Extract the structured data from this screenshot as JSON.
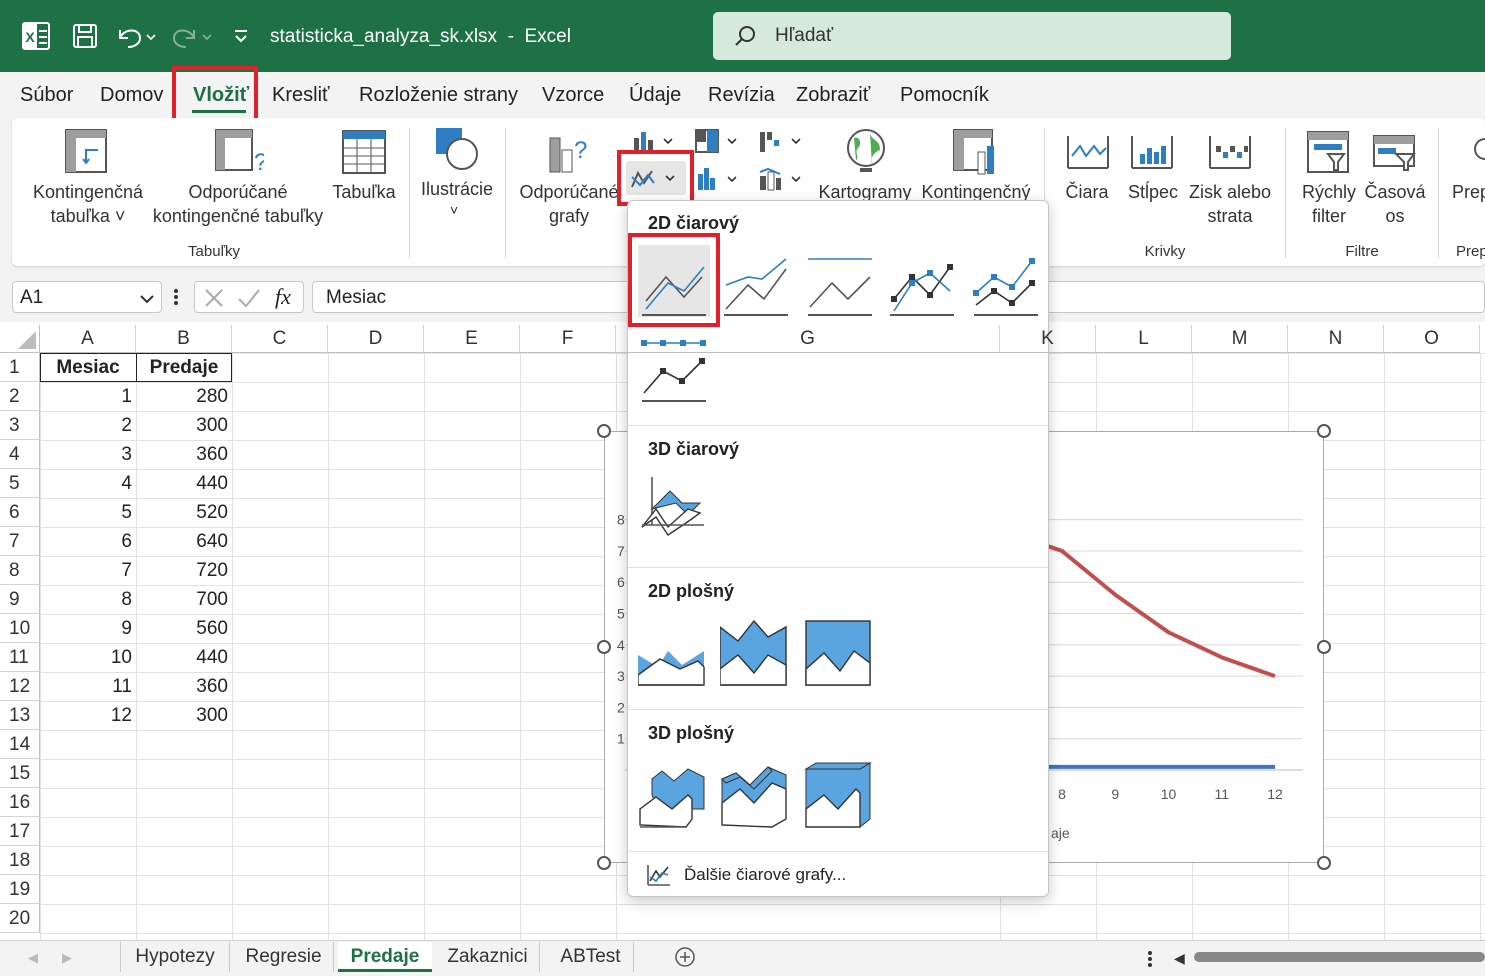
{
  "app": {
    "filename": "statisticka_analyza_sk.xlsx",
    "separator": "-",
    "appname": "Excel",
    "search_placeholder": "Hľadať"
  },
  "menu": [
    "Súbor",
    "Domov",
    "Vložiť",
    "Kresliť",
    "Rozloženie strany",
    "Vzorce",
    "Údaje",
    "Revízia",
    "Zobraziť",
    "Pomocník"
  ],
  "ribbon": {
    "pivot_table": "Kontingenčná tabuľka ˅",
    "pivot_table_l1": "Kontingenčná",
    "pivot_table_l2": "tabuľka ˅",
    "rec_pivot_l1": "Odporúčané",
    "rec_pivot_l2": "kontingenčné tabuľky",
    "table": "Tabuľka",
    "illustrations": "Ilustrácie",
    "rec_charts_l1": "Odporúčané",
    "rec_charts_l2": "grafy",
    "maps": "Kartogramy",
    "pivot_chart": "Kontingenčný",
    "line": "Čiara",
    "column": "Stĺpec",
    "winloss_l1": "Zisk alebo",
    "winloss_l2": "strata",
    "slicer_l1": "Rýchly",
    "slicer_l2": "filter",
    "timeline_l1": "Časová",
    "timeline_l2": "os",
    "prep": "Prep",
    "group_tables": "Tabuľky",
    "group_sparklines": "Krivky",
    "group_filters": "Filtre",
    "group_prep": "Prep"
  },
  "formula_bar": {
    "name_box": "A1",
    "fx": "fx",
    "content": "Mesiac"
  },
  "columns": [
    "A",
    "B",
    "C",
    "D",
    "E",
    "F",
    "G",
    "K",
    "L",
    "M",
    "N",
    "O"
  ],
  "rows": [
    "1",
    "2",
    "3",
    "4",
    "5",
    "6",
    "7",
    "8",
    "9",
    "10",
    "11",
    "12",
    "13",
    "14",
    "15",
    "16",
    "17",
    "18",
    "19",
    "20"
  ],
  "table": {
    "headers": [
      "Mesiac",
      "Predaje"
    ],
    "data": [
      [
        "1",
        "280"
      ],
      [
        "2",
        "300"
      ],
      [
        "3",
        "360"
      ],
      [
        "4",
        "440"
      ],
      [
        "5",
        "520"
      ],
      [
        "6",
        "640"
      ],
      [
        "7",
        "720"
      ],
      [
        "8",
        "700"
      ],
      [
        "9",
        "560"
      ],
      [
        "10",
        "440"
      ],
      [
        "11",
        "360"
      ],
      [
        "12",
        "300"
      ]
    ]
  },
  "chart_data": {
    "type": "line",
    "x": [
      "8",
      "9",
      "10",
      "11",
      "12"
    ],
    "y_ticks_visible": [
      "8",
      "7",
      "6",
      "5",
      "4",
      "3",
      "2",
      "1"
    ],
    "series": [
      {
        "color": "#c0504d",
        "values": [
          7.0,
          5.6,
          4.4,
          3.6,
          3.0
        ]
      },
      {
        "color": "#4472c4",
        "values": [
          0.1,
          0.1,
          0.1,
          0.1,
          0.1
        ]
      }
    ],
    "legend_fragment": "aje"
  },
  "dropdown": {
    "sec_2d_line": "2D čiarový",
    "sec_3d_line": "3D čiarový",
    "sec_2d_area": "2D plošný",
    "sec_3d_area": "3D plošný",
    "more": "Ďalšie čiarové grafy..."
  },
  "sheets": [
    "Hypotezy",
    "Regresie",
    "Predaje",
    "Zakaznici",
    "ABTest"
  ],
  "active_sheet": "Predaje",
  "colors": {
    "brand": "#1e7145",
    "highlight": "#e0202a",
    "accent_blue": "#2e7fc1"
  }
}
